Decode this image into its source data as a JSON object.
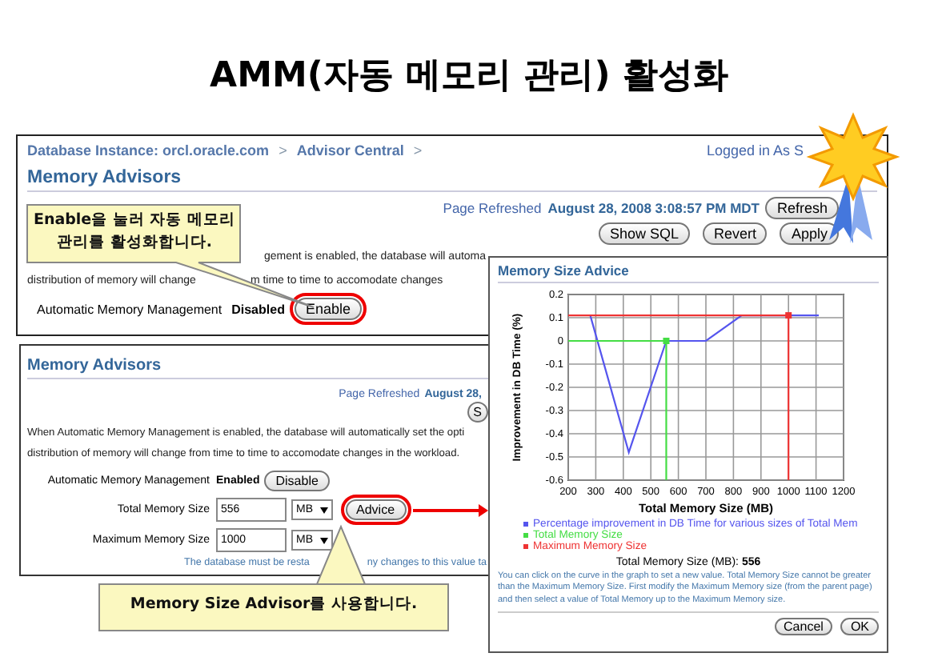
{
  "slide_title": "AMM(자동 메모리 관리) 활성화",
  "main_window": {
    "breadcrumb": [
      {
        "kind": "link",
        "text": "Database Instance: orcl.oracle.com"
      },
      {
        "kind": "separator",
        "text": ">"
      },
      {
        "kind": "link",
        "text": "Advisor Central"
      },
      {
        "kind": "separator",
        "text": ">"
      }
    ],
    "user": "Logged in As S",
    "heading": "Memory Advisors",
    "refreshed_label": "Page Refreshed",
    "refreshed_time": "August 28, 2008 3:08:57 PM MDT",
    "refresh_button": "Refresh",
    "buttons": [
      "Show SQL",
      "Revert",
      "Apply"
    ],
    "description": [
      [
        "gement is enabled, the database will automa"
      ],
      [
        "distribution of memory will change",
        "m time to time to accomodate changes"
      ]
    ],
    "amm": {
      "label": "Automatic Memory Management",
      "status": "Disabled",
      "button": "Enable",
      "highlighted": true
    }
  },
  "second_window": {
    "heading": "Memory Advisors",
    "refreshed_label": "Page Refreshed",
    "refreshed_time": "August 28,",
    "button": "S",
    "description": [
      "When Automatic Memory Management is enabled, the database will automatically set the opti",
      "distribution of memory will change from time to time to accomodate changes in the workload."
    ],
    "amm": {
      "label": "Automatic Memory Management",
      "status": "Enabled",
      "button": "Disable",
      "highlighted": false
    },
    "fields": [
      {
        "label": "Total Memory Size",
        "value": "556",
        "unit": "MB",
        "button": "Advice",
        "highlighted": true
      },
      {
        "label": "Maximum Memory Size",
        "value": "1000",
        "unit": "MB"
      }
    ],
    "note": [
      "The database must be resta",
      "ny changes to this value ta"
    ]
  },
  "callouts": [
    {
      "text": "Enable을 눌러 자동 메모리 관리를 활성화합니다."
    },
    {
      "text": "Memory Size Advisor를 사용합니다."
    }
  ],
  "dialog": {
    "title": "Memory Size Advice",
    "chart_data": {
      "type": "line",
      "xlabel": "Total Memory Size (MB)",
      "ylabel": "Improvement in DB Time (%)",
      "x": [
        200,
        280,
        420,
        556,
        556,
        700,
        830,
        1000,
        1000,
        1110
      ],
      "grid": true,
      "series": [
        {
          "name": "Percentage improvement in DB Time for various sizes of Total Mem",
          "color": "#5555ee",
          "values": [
            null,
            0.11,
            -0.48,
            0,
            null,
            0,
            0.11,
            0.11,
            null,
            0.11
          ]
        },
        {
          "name": "Total Memory Size",
          "color": "#44dd44",
          "marker": true,
          "values": [
            0,
            null,
            null,
            0,
            -0.6,
            null,
            null,
            null,
            null,
            null
          ]
        },
        {
          "name": "Maximum Memory Size",
          "color": "#ee3333",
          "marker": true,
          "values": [
            0.11,
            null,
            null,
            null,
            null,
            null,
            null,
            0.11,
            -0.6,
            null
          ]
        }
      ],
      "xlim": [
        200,
        1200
      ],
      "ylim": [
        -0.6,
        0.2
      ],
      "xticks": [
        200,
        300,
        400,
        500,
        600,
        700,
        800,
        900,
        1000,
        1100,
        1200
      ],
      "yticks": [
        -0.6,
        -0.5,
        -0.4,
        -0.3,
        -0.2,
        -0.1,
        0,
        0.1,
        0.2
      ]
    },
    "total_label": "Total Memory Size (MB):",
    "total_value": "556",
    "help": "You can click on the curve in the graph to set a new value. Total Memory Size cannot be greater than the Maximum Memory Size. First modify the Maximum Memory size (from the parent page) and then select a value of Total Memory up to the Maximum Memory size.",
    "buttons": [
      "Cancel",
      "OK"
    ]
  }
}
